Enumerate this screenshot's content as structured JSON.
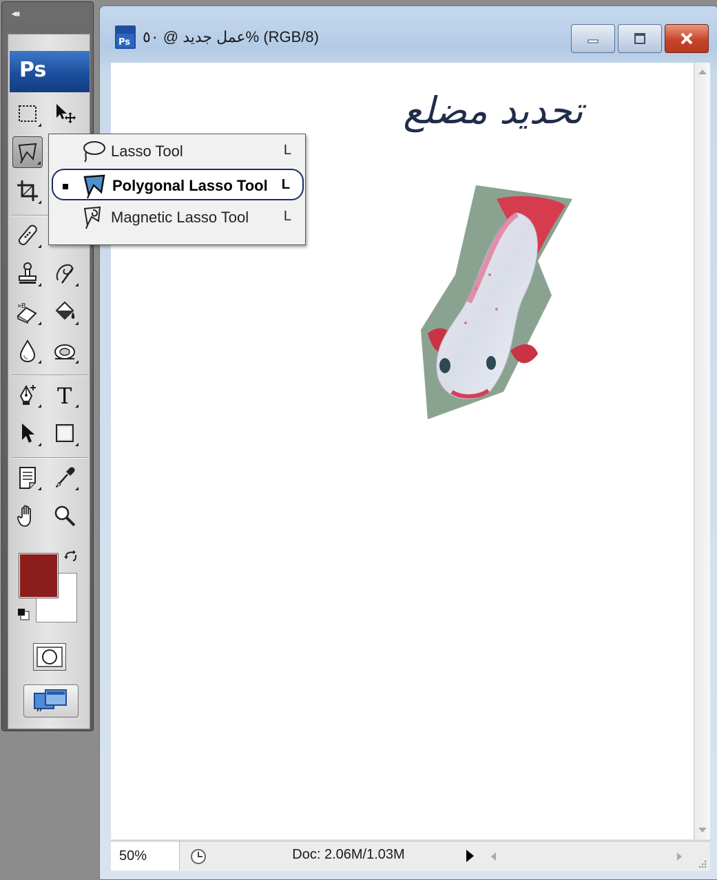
{
  "app": {
    "logo_text": "Ps",
    "collapse_label": "◂◂"
  },
  "document": {
    "title": "عمل جديد @ ٥٠% (RGB/8)",
    "icon_label": "Ps",
    "heading": "تحديد مضلع"
  },
  "tool_flyout": {
    "items": [
      {
        "label": "Lasso Tool",
        "shortcut": "L",
        "selected": false
      },
      {
        "label": "Polygonal Lasso Tool",
        "shortcut": "L",
        "selected": true
      },
      {
        "label": "Magnetic Lasso Tool",
        "shortcut": "L",
        "selected": false
      }
    ]
  },
  "colors": {
    "foreground": "#8c1d1d",
    "background": "#ffffff"
  },
  "status_bar": {
    "zoom": "50%",
    "doc_info": "Doc: 2.06M/1.03M"
  },
  "icons": [
    "marquee-icon",
    "move-icon",
    "polygonal-lasso-icon",
    "crop-icon",
    "healing-brush-icon",
    "brush-icon",
    "clone-stamp-icon",
    "history-brush-icon",
    "eraser-icon",
    "paint-bucket-icon",
    "blur-icon",
    "dodge-icon",
    "pen-icon",
    "type-icon",
    "path-selection-icon",
    "rectangle-icon",
    "notes-icon",
    "eyedropper-icon",
    "hand-icon",
    "zoom-icon"
  ]
}
